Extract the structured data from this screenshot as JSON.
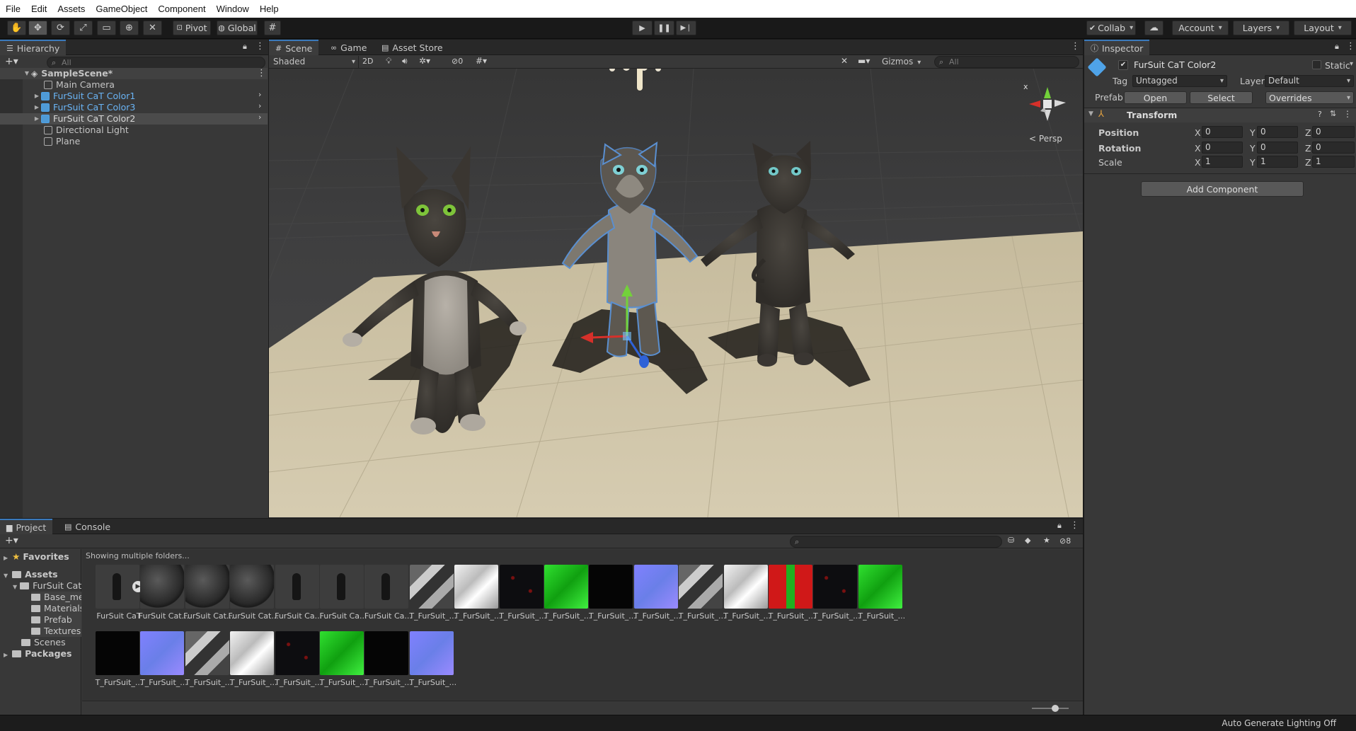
{
  "menu": [
    "File",
    "Edit",
    "Assets",
    "GameObject",
    "Component",
    "Window",
    "Help"
  ],
  "toolbar": {
    "pivot_label": "Pivot",
    "global_label": "Global",
    "collab_label": "Collab",
    "account_label": "Account",
    "layers_label": "Layers",
    "layout_label": "Layout"
  },
  "hierarchy": {
    "tab": "Hierarchy",
    "search_placeholder": "All",
    "scene_name": "SampleScene*",
    "items": [
      {
        "label": "Main Camera"
      },
      {
        "label": "FurSuit CaT Color1"
      },
      {
        "label": "FurSuit CaT Color3"
      },
      {
        "label": "FurSuit CaT Color2"
      },
      {
        "label": "Directional Light"
      },
      {
        "label": "Plane"
      }
    ]
  },
  "scene": {
    "tabs": [
      "Scene",
      "Game",
      "Asset Store"
    ],
    "shading": "Shaded",
    "mode_2d": "2D",
    "hidden_count": "0",
    "gizmos_label": "Gizmos",
    "search_placeholder": "All",
    "persp_label": "Persp",
    "axis_y": "y",
    "axis_x": "x"
  },
  "inspector": {
    "tab": "Inspector",
    "object_name": "FurSuit CaT Color2",
    "static_label": "Static",
    "tag_label": "Tag",
    "tag_value": "Untagged",
    "layer_label": "Layer",
    "layer_value": "Default",
    "prefab_label": "Prefab",
    "open_label": "Open",
    "select_label": "Select",
    "overrides_label": "Overrides",
    "transform_title": "Transform",
    "rows": [
      {
        "label": "Position",
        "x": "0",
        "y": "0",
        "z": "0"
      },
      {
        "label": "Rotation",
        "x": "0",
        "y": "0",
        "z": "0"
      },
      {
        "label": "Scale",
        "x": "1",
        "y": "1",
        "z": "1"
      }
    ],
    "axis_x": "X",
    "axis_y": "Y",
    "axis_z": "Z",
    "add_component": "Add Component"
  },
  "project": {
    "tabs": [
      "Project",
      "Console"
    ],
    "hidden_count": "8",
    "breadcrumb": "Showing multiple folders...",
    "favorites": "Favorites",
    "assets": "Assets",
    "fursuit": "FurSuit Cat",
    "base_mesh": "Base_mes",
    "materials": "Materials",
    "prefab": "Prefab",
    "textures": "Textures",
    "scenes": "Scenes",
    "packages": "Packages",
    "items": [
      {
        "label": "FurSuit CaT",
        "kind": "prefab"
      },
      {
        "label": "FurSuit Cat...",
        "kind": "sphere"
      },
      {
        "label": "FurSuit Cat...",
        "kind": "sphere"
      },
      {
        "label": "FurSuit Cat...",
        "kind": "sphere"
      },
      {
        "label": "FurSuit Ca...",
        "kind": "model"
      },
      {
        "label": "FurSuit Ca...",
        "kind": "model"
      },
      {
        "label": "FurSuit Ca...",
        "kind": "model"
      },
      {
        "label": "T_FurSuit_...",
        "kind": "tex-mix"
      },
      {
        "label": "T_FurSuit_...",
        "kind": "tex-white"
      },
      {
        "label": "T_FurSuit_...",
        "kind": "tex-dark"
      },
      {
        "label": "T_FurSuit_...",
        "kind": "tex-green"
      },
      {
        "label": "T_FurSuit_...",
        "kind": "tex-black"
      },
      {
        "label": "T_FurSuit_...",
        "kind": "tex-normal"
      },
      {
        "label": "T_FurSuit_...",
        "kind": "tex-mix"
      },
      {
        "label": "T_FurSuit_...",
        "kind": "tex-white"
      },
      {
        "label": "T_FurSuit_...",
        "kind": "tex-red"
      },
      {
        "label": "T_FurSuit_...",
        "kind": "tex-dark"
      },
      {
        "label": "T_FurSuit_...",
        "kind": "tex-green"
      },
      {
        "label": "T_FurSuit_...",
        "kind": "tex-black"
      },
      {
        "label": "T_FurSuit_...",
        "kind": "tex-normal"
      },
      {
        "label": "T_FurSuit_...",
        "kind": "tex-mix"
      },
      {
        "label": "T_FurSuit_...",
        "kind": "tex-white"
      },
      {
        "label": "T_FurSuit_...",
        "kind": "tex-dark"
      },
      {
        "label": "T_FurSuit_...",
        "kind": "tex-green"
      },
      {
        "label": "T_FurSuit_...",
        "kind": "tex-black"
      },
      {
        "label": "T_FurSuit_...",
        "kind": "tex-normal"
      }
    ]
  },
  "status": {
    "text": "Auto Generate Lighting Off"
  },
  "colors": {
    "accent": "#3a79bb",
    "selection": "#4b4b4b",
    "floor": "#cbbf9f",
    "cat_dark": "#3f3b36",
    "cat_light": "#a9a39b"
  }
}
